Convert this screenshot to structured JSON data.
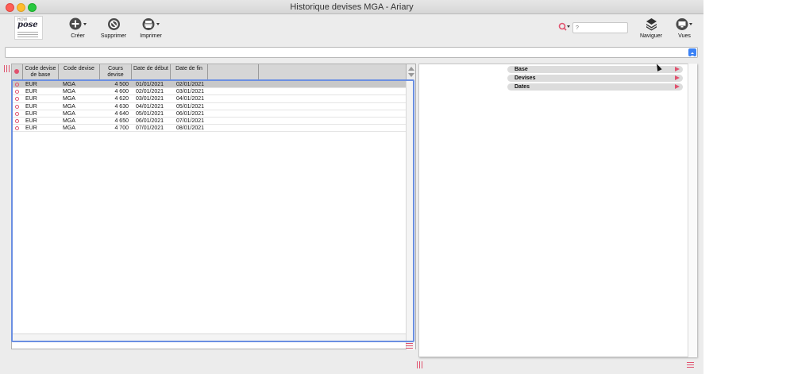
{
  "window": {
    "title": "Historique devises MGA - Ariary"
  },
  "logo": {
    "top_text": "HOW",
    "brand": "pose"
  },
  "toolbar": {
    "create_label": "Créer",
    "delete_label": "Supprimer",
    "print_label": "Imprimer",
    "navigate_label": "Naviguer",
    "views_label": "Vues"
  },
  "search": {
    "placeholder": "?"
  },
  "table": {
    "columns": [
      "Code devise de base",
      "Code devise",
      "Cours devise",
      "Date de début",
      "Date de fin"
    ],
    "rows": [
      {
        "base": "EUR",
        "code": "MGA",
        "rate": "4 500",
        "start": "01/01/2021",
        "end": "02/01/2021",
        "selected": true
      },
      {
        "base": "EUR",
        "code": "MGA",
        "rate": "4 600",
        "start": "02/01/2021",
        "end": "03/01/2021",
        "selected": false
      },
      {
        "base": "EUR",
        "code": "MGA",
        "rate": "4 620",
        "start": "03/01/2021",
        "end": "04/01/2021",
        "selected": false
      },
      {
        "base": "EUR",
        "code": "MGA",
        "rate": "4 630",
        "start": "04/01/2021",
        "end": "05/01/2021",
        "selected": false
      },
      {
        "base": "EUR",
        "code": "MGA",
        "rate": "4 640",
        "start": "05/01/2021",
        "end": "06/01/2021",
        "selected": false
      },
      {
        "base": "EUR",
        "code": "MGA",
        "rate": "4 650",
        "start": "06/01/2021",
        "end": "07/01/2021",
        "selected": false
      },
      {
        "base": "EUR",
        "code": "MGA",
        "rate": "4 700",
        "start": "07/01/2021",
        "end": "08/01/2021",
        "selected": false
      }
    ]
  },
  "detail": {
    "sections": [
      {
        "label": "Base"
      },
      {
        "label": "Devises"
      },
      {
        "label": "Dates"
      }
    ]
  },
  "colors": {
    "accent": "#e0526e",
    "focus": "#6b8fe2",
    "select_blue": "#3b82f6"
  }
}
